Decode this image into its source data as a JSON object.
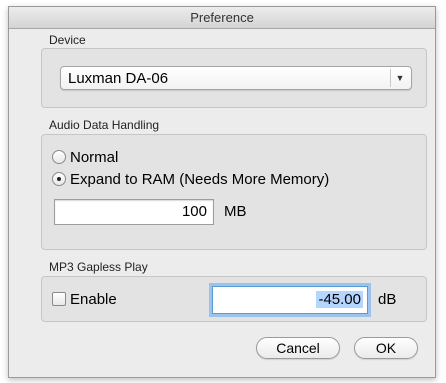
{
  "window": {
    "title": "Preference"
  },
  "device": {
    "section_label": "Device",
    "selected": "Luxman DA-06",
    "arrow_icon": "popup-arrow-icon"
  },
  "audio": {
    "section_label": "Audio Data Handling",
    "options": [
      {
        "label": "Normal",
        "checked": false
      },
      {
        "label": "Expand to RAM (Needs More Memory)",
        "checked": true
      }
    ],
    "memory_value": "100",
    "memory_unit": "MB"
  },
  "mp3": {
    "section_label": "MP3 Gapless Play",
    "enable_label": "Enable",
    "enable_checked": false,
    "gain_value": "-45.00",
    "gain_unit": "dB"
  },
  "buttons": {
    "cancel": "Cancel",
    "ok": "OK"
  }
}
